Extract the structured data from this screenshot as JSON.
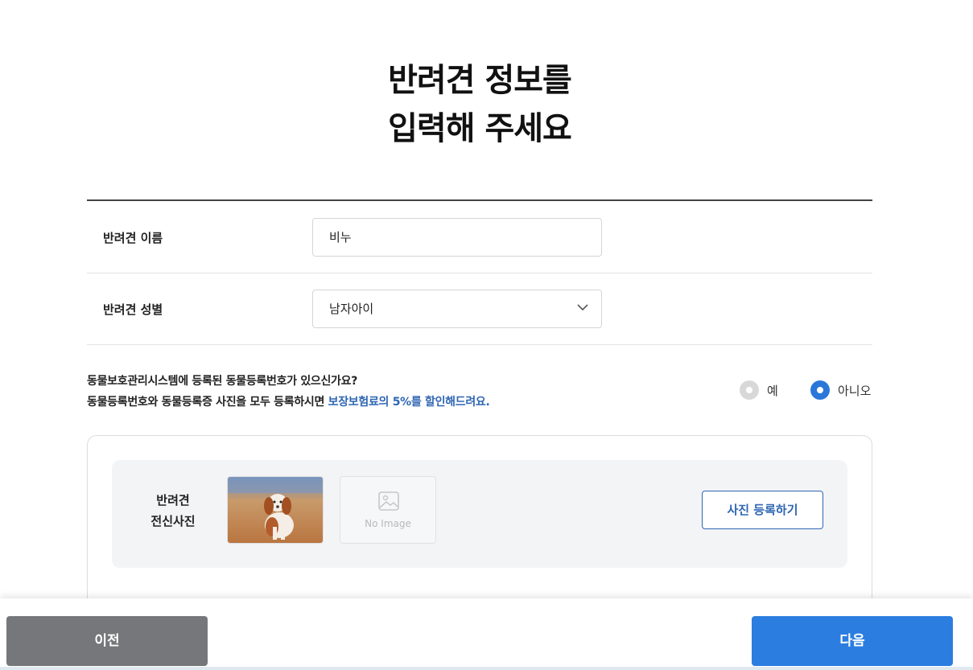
{
  "page": {
    "title_line1": "반려견 정보를",
    "title_line2": "입력해 주세요"
  },
  "form": {
    "name": {
      "label": "반려견 이름",
      "value": "비누"
    },
    "gender": {
      "label": "반려견 성별",
      "value": "남자아이",
      "icon": "chevron-down-icon"
    }
  },
  "registration": {
    "question_line1": "동물보호관리시스템에 등록된 동물등록번호가 있으신가요?",
    "question_line2_prefix": "동물등록번호와 동물등록증 사진을 모두 등록하시면 ",
    "question_line2_highlight": "보장보험료의 5%를 할인해드려요.",
    "highlight_color": "#2f66b3",
    "options": [
      {
        "label": "예",
        "selected": false
      },
      {
        "label": "아니오",
        "selected": true
      }
    ]
  },
  "photo": {
    "label_line1": "반려견",
    "label_line2": "전신사진",
    "no_image_text": "No Image",
    "upload_button": "사진 등록하기",
    "accent_color": "#2f66b3"
  },
  "footer": {
    "prev_label": "이전",
    "next_label": "다음",
    "prev_color": "#76777a",
    "next_color": "#2b7de0"
  }
}
